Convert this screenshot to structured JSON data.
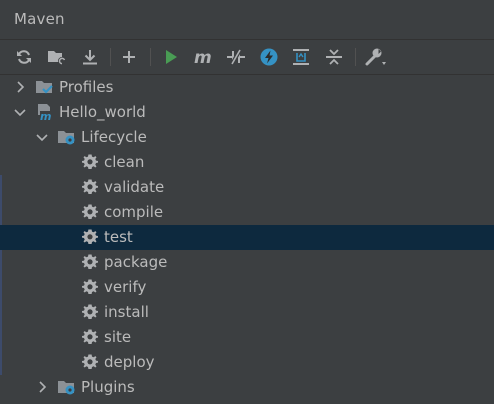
{
  "window": {
    "title": "Maven"
  },
  "toolbar": {
    "buttons": [
      {
        "name": "reload-all-icon"
      },
      {
        "name": "generate-sources-icon"
      },
      {
        "name": "download-sources-icon"
      },
      {
        "name": "add-maven-project-icon"
      },
      {
        "name": "run-maven-build-icon"
      },
      {
        "name": "execute-maven-goal-icon"
      },
      {
        "name": "toggle-offline-mode-icon"
      },
      {
        "name": "skip-tests-icon"
      },
      {
        "name": "show-dependencies-icon"
      },
      {
        "name": "collapse-all-icon"
      },
      {
        "name": "maven-settings-icon"
      }
    ],
    "colors": {
      "run": "#499c54",
      "skip_tests": "#3592c4",
      "icon": "#afb1b3"
    }
  },
  "tree": {
    "profiles": {
      "label": "Profiles"
    },
    "project": {
      "label": "Hello_world"
    },
    "lifecycle": {
      "label": "Lifecycle",
      "goals": [
        "clean",
        "validate",
        "compile",
        "test",
        "package",
        "verify",
        "install",
        "site",
        "deploy"
      ],
      "selected": "test"
    },
    "plugins": {
      "label": "Plugins"
    }
  },
  "colors": {
    "selection": "#0d293e",
    "text": "#bbbbbb",
    "background": "#3c3f41"
  }
}
